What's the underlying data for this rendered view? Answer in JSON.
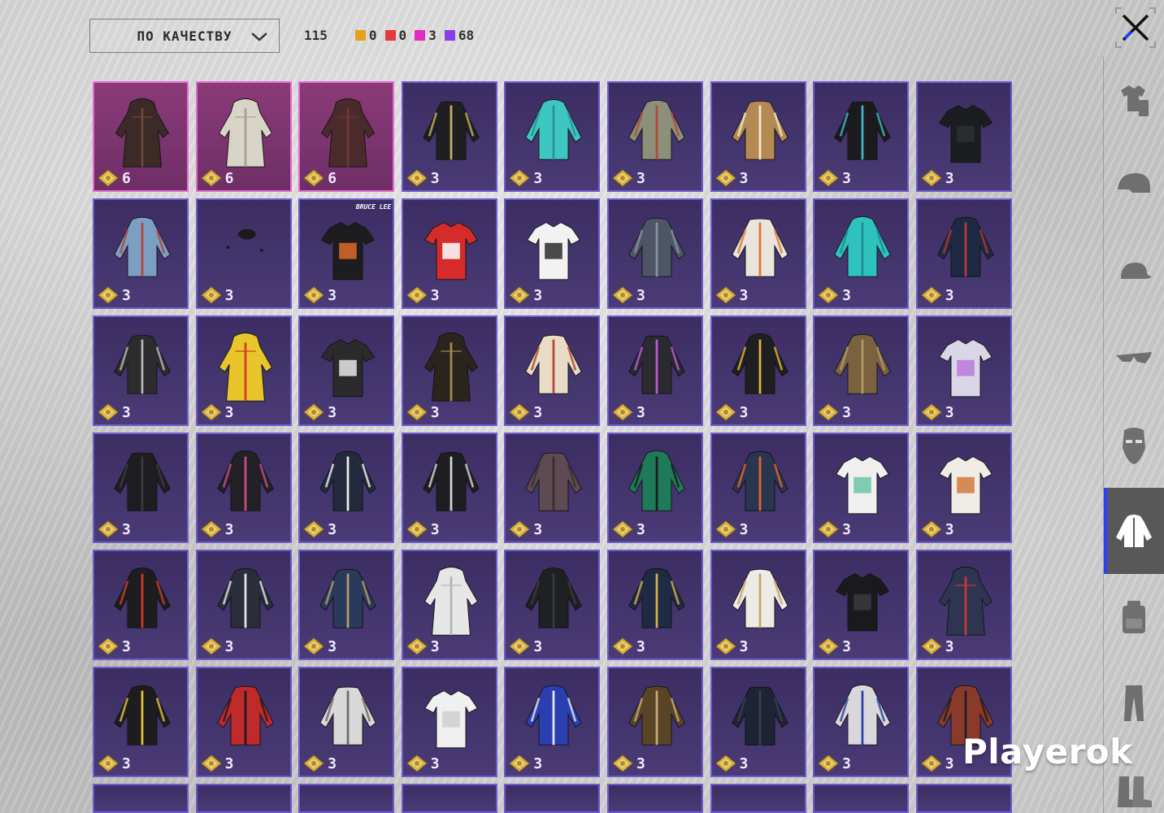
{
  "header": {
    "sort_label": "ПО КАЧЕСТВУ",
    "total_count": "115",
    "quality_counts": [
      {
        "value": "0",
        "color": "#e6a21c"
      },
      {
        "value": "0",
        "color": "#e63a3a"
      },
      {
        "value": "3",
        "color": "#e22bc1"
      },
      {
        "value": "68",
        "color": "#8a3de6"
      }
    ]
  },
  "sidebar": {
    "items": [
      {
        "name": "outfit-tab",
        "icon": "outfit-icon",
        "active": false
      },
      {
        "name": "helmet-tab",
        "icon": "helmet-icon",
        "active": false
      },
      {
        "name": "cap-tab",
        "icon": "cap-icon",
        "active": false
      },
      {
        "name": "glasses-tab",
        "icon": "glasses-icon",
        "active": false
      },
      {
        "name": "mask-tab",
        "icon": "mask-icon",
        "active": false
      },
      {
        "name": "jacket-tab",
        "icon": "jacket-icon",
        "active": true
      },
      {
        "name": "backpack-tab",
        "icon": "backpack-icon",
        "active": false
      },
      {
        "name": "pants-tab",
        "icon": "pants-icon",
        "active": false
      },
      {
        "name": "boots-tab",
        "icon": "boots-icon",
        "active": false
      }
    ]
  },
  "inventory": {
    "items": [
      {
        "qty": "6",
        "rarity": "pink",
        "icon": "trench-coat-hooded-icon",
        "c1": "#3b2a26",
        "c2": "#6b4a3a"
      },
      {
        "qty": "6",
        "rarity": "pink",
        "icon": "white-hooded-coat-icon",
        "c1": "#d9d4c8",
        "c2": "#a8a08f"
      },
      {
        "qty": "6",
        "rarity": "pink",
        "icon": "long-coat-icon",
        "c1": "#4a2a2a",
        "c2": "#6e3a34"
      },
      {
        "qty": "3",
        "rarity": "purple",
        "icon": "black-hooded-jacket-icon",
        "c1": "#1f1f22",
        "c2": "#c8b060"
      },
      {
        "qty": "3",
        "rarity": "purple",
        "icon": "teal-hoodie-icon",
        "c1": "#3ec6c0",
        "c2": "#2b8f9c"
      },
      {
        "qty": "3",
        "rarity": "purple",
        "icon": "olive-hoodie-icon",
        "c1": "#8c8f7a",
        "c2": "#b24a3a"
      },
      {
        "qty": "3",
        "rarity": "purple",
        "icon": "snake-jacket-icon",
        "c1": "#b58a52",
        "c2": "#f0ead8"
      },
      {
        "qty": "3",
        "rarity": "purple",
        "icon": "black-hoodie-icon",
        "c1": "#1b1b1e",
        "c2": "#3fb7c7"
      },
      {
        "qty": "3",
        "rarity": "purple",
        "icon": "crop-top-icon",
        "c1": "#1c1d20",
        "c2": "#2e2f33"
      },
      {
        "qty": "3",
        "rarity": "purple",
        "icon": "denim-jacket-icon",
        "c1": "#7d9ec3",
        "c2": "#b5423c"
      },
      {
        "qty": "3",
        "rarity": "purple",
        "icon": "small-accessory-icon",
        "c1": "#1a1a1a",
        "c2": "#333"
      },
      {
        "qty": "3",
        "rarity": "purple",
        "icon": "bruce-lee-tshirt-icon",
        "c1": "#1d1d1f",
        "c2": "#e1692a",
        "overlay": "BRUCE LEE"
      },
      {
        "qty": "3",
        "rarity": "purple",
        "icon": "red-tshirt-icon",
        "c1": "#d62b2b",
        "c2": "#ffffff"
      },
      {
        "qty": "3",
        "rarity": "purple",
        "icon": "white-tshirt-icon",
        "c1": "#f2f2f2",
        "c2": "#2b2b2b"
      },
      {
        "qty": "3",
        "rarity": "purple",
        "icon": "metal-vest-icon",
        "c1": "#4d5566",
        "c2": "#8a93a6"
      },
      {
        "qty": "3",
        "rarity": "purple",
        "icon": "flame-hoodie-icon",
        "c1": "#e9e4dc",
        "c2": "#e0782a"
      },
      {
        "qty": "3",
        "rarity": "purple",
        "icon": "aqua-hoodie-icon",
        "c1": "#2fc2bd",
        "c2": "#1e8b94"
      },
      {
        "qty": "3",
        "rarity": "purple",
        "icon": "navy-jacket-icon",
        "c1": "#1e2a44",
        "c2": "#b83636"
      },
      {
        "qty": "3",
        "rarity": "purple",
        "icon": "grey-hooded-jacket-icon",
        "c1": "#2c2c2e",
        "c2": "#b8b8b8"
      },
      {
        "qty": "3",
        "rarity": "purple",
        "icon": "yellow-robe-icon",
        "c1": "#e8c52a",
        "c2": "#d23a2a"
      },
      {
        "qty": "3",
        "rarity": "purple",
        "icon": "walking-dead-tshirt-icon",
        "c1": "#2b2b2e",
        "c2": "#e8e8e8"
      },
      {
        "qty": "3",
        "rarity": "purple",
        "icon": "gold-coat-icon",
        "c1": "#2a241c",
        "c2": "#a88a52"
      },
      {
        "qty": "3",
        "rarity": "purple",
        "icon": "padded-vest-icon",
        "c1": "#e8dcc6",
        "c2": "#b0463a"
      },
      {
        "qty": "3",
        "rarity": "purple",
        "icon": "purple-stripe-jacket-icon",
        "c1": "#2a2a30",
        "c2": "#c05ad8"
      },
      {
        "qty": "3",
        "rarity": "purple",
        "icon": "gold-black-jacket-icon",
        "c1": "#1f1f22",
        "c2": "#e0b53a"
      },
      {
        "qty": "3",
        "rarity": "purple",
        "icon": "camo-jacket-icon",
        "c1": "#7a6240",
        "c2": "#b59a6a"
      },
      {
        "qty": "3",
        "rarity": "purple",
        "icon": "lilac-tshirt-icon",
        "c1": "#d9d6e6",
        "c2": "#b77ad8"
      },
      {
        "qty": "3",
        "rarity": "purple",
        "icon": "leather-jacket-icon",
        "c1": "#1e1e22",
        "c2": "#3a3a3f"
      },
      {
        "qty": "3",
        "rarity": "purple",
        "icon": "pink-zip-jacket-icon",
        "c1": "#222226",
        "c2": "#d04a8a"
      },
      {
        "qty": "3",
        "rarity": "purple",
        "icon": "blazer-white-shirt-icon",
        "c1": "#232a3e",
        "c2": "#f0f0f0"
      },
      {
        "qty": "3",
        "rarity": "purple",
        "icon": "black-zip-jacket-icon",
        "c1": "#1e1e22",
        "c2": "#d8d8d8"
      },
      {
        "qty": "3",
        "rarity": "purple",
        "icon": "brown-hoodie-icon",
        "c1": "#5e4a52",
        "c2": "#3a2e33"
      },
      {
        "qty": "3",
        "rarity": "purple",
        "icon": "green-jacket-icon",
        "c1": "#1f7a5a",
        "c2": "#1b1b1e"
      },
      {
        "qty": "3",
        "rarity": "purple",
        "icon": "orange-sleeve-jacket-icon",
        "c1": "#2a3550",
        "c2": "#e8652a"
      },
      {
        "qty": "3",
        "rarity": "purple",
        "icon": "floral-sleeve-top-icon",
        "c1": "#f0f0f0",
        "c2": "#6ec4a8"
      },
      {
        "qty": "3",
        "rarity": "purple",
        "icon": "tiger-sleeve-top-icon",
        "c1": "#f0ece6",
        "c2": "#d07a3a"
      },
      {
        "qty": "3",
        "rarity": "purple",
        "icon": "graphic-hoodie-icon",
        "c1": "#1d1d20",
        "c2": "#d23a2a"
      },
      {
        "qty": "3",
        "rarity": "purple",
        "icon": "bloody-shirt-jacket-icon",
        "c1": "#2a2e3a",
        "c2": "#e6e6e6"
      },
      {
        "qty": "3",
        "rarity": "purple",
        "icon": "denim-hooded-jacket-icon",
        "c1": "#2a3a5a",
        "c2": "#b5a06a"
      },
      {
        "qty": "3",
        "rarity": "purple",
        "icon": "lab-coat-icon",
        "c1": "#e6e6e6",
        "c2": "#b3b3b3"
      },
      {
        "qty": "3",
        "rarity": "purple",
        "icon": "black-tunic-icon",
        "c1": "#1f2024",
        "c2": "#3a3b40"
      },
      {
        "qty": "3",
        "rarity": "purple",
        "icon": "naval-jacket-icon",
        "c1": "#1f2a44",
        "c2": "#d8b24a"
      },
      {
        "qty": "3",
        "rarity": "purple",
        "icon": "white-uniform-icon",
        "c1": "#ecebe6",
        "c2": "#c9a46a"
      },
      {
        "qty": "3",
        "rarity": "purple",
        "icon": "sports-bra-icon",
        "c1": "#1a1a1c",
        "c2": "#3a3a3e"
      },
      {
        "qty": "3",
        "rarity": "purple",
        "icon": "school-dress-icon",
        "c1": "#2e3550",
        "c2": "#c83a3a"
      },
      {
        "qty": "3",
        "rarity": "purple",
        "icon": "gold-pattern-jacket-icon",
        "c1": "#1d1d20",
        "c2": "#e6c23a"
      },
      {
        "qty": "3",
        "rarity": "purple",
        "icon": "plaid-vest-icon",
        "c1": "#c02a2a",
        "c2": "#1d1d20"
      },
      {
        "qty": "3",
        "rarity": "purple",
        "icon": "grey-zip-hoodie-icon",
        "c1": "#d8d8d8",
        "c2": "#6a6a6a"
      },
      {
        "qty": "3",
        "rarity": "purple",
        "icon": "white-tank-top-icon",
        "c1": "#f0f0f0",
        "c2": "#cfcfcf"
      },
      {
        "qty": "3",
        "rarity": "purple",
        "icon": "blue-racing-jacket-icon",
        "c1": "#2a3fb0",
        "c2": "#e8e8e8"
      },
      {
        "qty": "3",
        "rarity": "purple",
        "icon": "bomber-jacket-icon",
        "c1": "#5a4426",
        "c2": "#c8aa7a"
      },
      {
        "qty": "3",
        "rarity": "purple",
        "icon": "suit-jacket-icon",
        "c1": "#1f2434",
        "c2": "#3a4054"
      },
      {
        "qty": "3",
        "rarity": "purple",
        "icon": "blue-white-jacket-icon",
        "c1": "#d8d8dc",
        "c2": "#2a3fa0"
      },
      {
        "qty": "3",
        "rarity": "purple",
        "icon": "red-leather-jacket-icon",
        "c1": "#8a3a2a",
        "c2": "#1d1d20"
      }
    ],
    "partial_row_count": 9
  },
  "watermark": "Playerok"
}
